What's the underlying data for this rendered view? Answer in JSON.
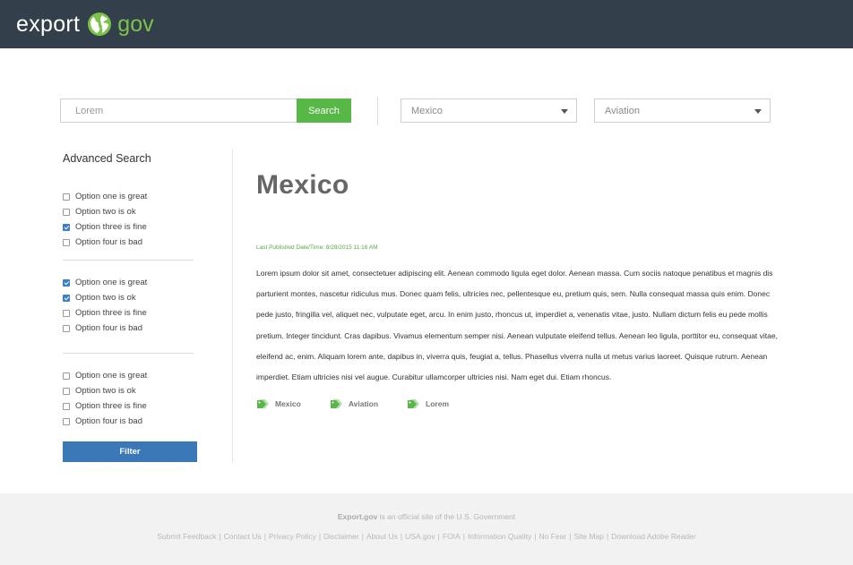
{
  "header": {
    "logo_left": "export",
    "logo_right": "gov",
    "colors": {
      "bar": "#333f4b",
      "accent": "#7cc24a"
    }
  },
  "search": {
    "placeholder": "Lorem",
    "button_label": "Search",
    "country_select": "Mexico",
    "industry_select": "Aviation"
  },
  "sidebar": {
    "title": "Advanced Search",
    "groups": [
      {
        "options": [
          {
            "label": "Option one is great",
            "checked": false
          },
          {
            "label": "Option two is ok",
            "checked": false
          },
          {
            "label": "Option three is fine",
            "checked": true
          },
          {
            "label": "Option four is bad",
            "checked": false
          }
        ]
      },
      {
        "options": [
          {
            "label": "Option one is great",
            "checked": true
          },
          {
            "label": "Option two is ok",
            "checked": true
          },
          {
            "label": "Option three is fine",
            "checked": false
          },
          {
            "label": "Option four is bad",
            "checked": false
          }
        ]
      },
      {
        "options": [
          {
            "label": "Option one is great",
            "checked": false
          },
          {
            "label": "Option two is ok",
            "checked": false
          },
          {
            "label": "Option three is fine",
            "checked": false
          },
          {
            "label": "Option four is bad",
            "checked": false
          }
        ]
      }
    ],
    "filter_label": "Filter"
  },
  "main": {
    "title": "Mexico",
    "published": "Last Published Date/Time: 8/28/2015 11:16 AM",
    "body": "Lorem ipsum dolor sit amet, consectetuer adipiscing elit. Aenean commodo ligula eget dolor. Aenean massa. Cum sociis natoque penatibus et magnis dis parturient montes, nascetur ridiculus mus. Donec quam felis, ultricies nec, pellentesque eu, pretium quis, sem. Nulla consequat massa quis enim. Donec pede justo, fringilla vel, aliquet nec, vulputate eget, arcu. In enim justo, rhoncus ut, imperdiet a, venenatis vitae, justo. Nullam dictum felis eu pede mollis pretium. Integer tincidunt. Cras dapibus. Vivamus elementum semper nisi. Aenean vulputate eleifend tellus. Aenean leo ligula, porttitor eu, consequat vitae, eleifend ac, enim. Aliquam lorem ante, dapibus in, viverra quis, feugiat a, tellus. Phasellus viverra nulla ut metus varius laoreet. Quisque rutrum. Aenean imperdiet. Etiam ultricies nisi vel augue. Curabitur ullamcorper ultricies nisi. Nam eget dui. Etiam rhoncus.",
    "tags": [
      "Mexico",
      "Aviation",
      "Lorem"
    ]
  },
  "footer": {
    "site_name": "Export.gov",
    "official_text": "is an official site of the U.S. Government",
    "links": [
      "Submit Feedback",
      "Contact Us",
      "Privacy Policy",
      "Disclaimer",
      "About Us",
      "USA.gov",
      "FOIA",
      "Information Quality",
      "No Fear",
      "Site Map",
      "Download Adobe Reader"
    ]
  }
}
